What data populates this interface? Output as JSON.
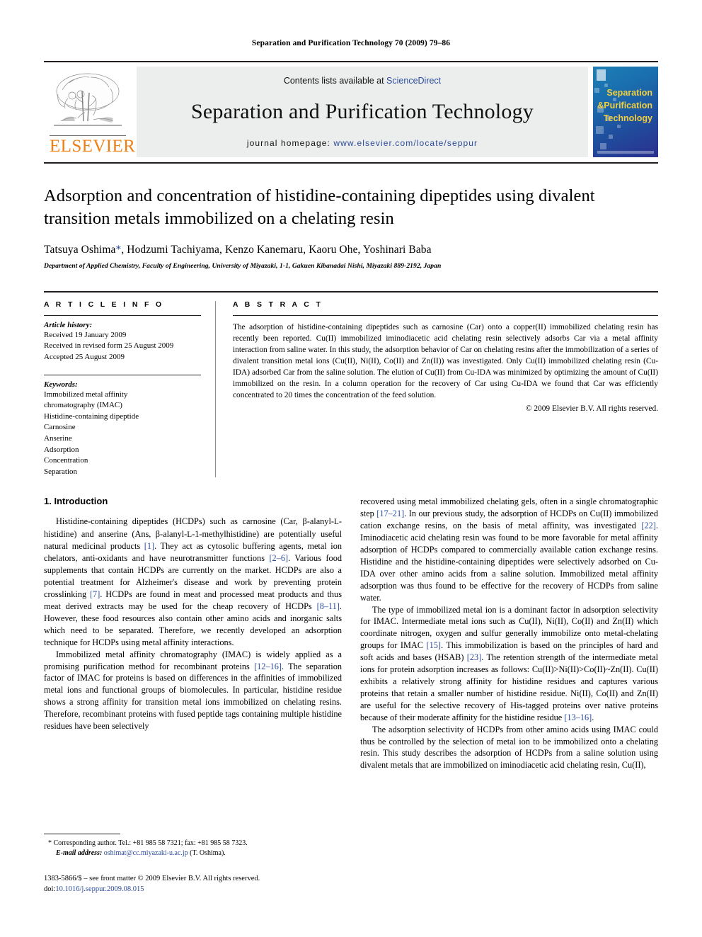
{
  "running_head": "Separation and Purification Technology 70 (2009) 79–86",
  "masthead": {
    "publisher_name": "ELSEVIER",
    "contents_prefix": "Contents lists available at ",
    "contents_link": "ScienceDirect",
    "journal_title": "Separation and Purification Technology",
    "homepage_prefix": "journal homepage: ",
    "homepage_url": "www.elsevier.com/locate/seppur",
    "cover_title_line1": "Separation",
    "cover_title_line2": "&Purification",
    "cover_title_line3": "Technology"
  },
  "article": {
    "title": "Adsorption and concentration of histidine-containing dipeptides using divalent transition metals immobilized on a chelating resin",
    "authors": "Tatsuya Oshima",
    "authors_rest": ", Hodzumi Tachiyama, Kenzo Kanemaru, Kaoru Ohe, Yoshinari Baba",
    "corresponding_marker": "*",
    "affiliation": "Department of Applied Chemistry, Faculty of Engineering, University of Miyazaki, 1-1, Gakuen Kibanadai Nishi, Miyazaki 889-2192, Japan"
  },
  "article_info": {
    "heading": "A R T I C L E  I N F O",
    "history_label": "Article history:",
    "history": [
      "Received 19 January 2009",
      "Received in revised form 25 August 2009",
      "Accepted 25 August 2009"
    ],
    "keywords_label": "Keywords:",
    "keywords": [
      "Immobilized metal affinity",
      "chromatography (IMAC)",
      "Histidine-containing dipeptide",
      "Carnosine",
      "Anserine",
      "Adsorption",
      "Concentration",
      "Separation"
    ]
  },
  "abstract": {
    "heading": "A B S T R A C T",
    "text": "The adsorption of histidine-containing dipeptides such as carnosine (Car) onto a copper(II) immobilized chelating resin has recently been reported. Cu(II) immobilized iminodiacetic acid chelating resin selectively adsorbs Car via a metal affinity interaction from saline water. In this study, the adsorption behavior of Car on chelating resins after the immobilization of a series of divalent transition metal ions (Cu(II), Ni(II), Co(II) and Zn(II)) was investigated. Only Cu(II) immobilized chelating resin (Cu-IDA) adsorbed Car from the saline solution. The elution of Cu(II) from Cu-IDA was minimized by optimizing the amount of Cu(II) immobilized on the resin. In a column operation for the recovery of Car using Cu-IDA we found that Car was efficiently concentrated to 20 times the concentration of the feed solution.",
    "copyright": "© 2009 Elsevier B.V. All rights reserved."
  },
  "body": {
    "section_number_title": "1.  Introduction",
    "left_paragraphs": [
      {
        "segments": [
          {
            "t": "Histidine-containing dipeptides (HCDPs) such as carnosine (Car, β-alanyl-"
          },
          {
            "t": "L",
            "style": "sc"
          },
          {
            "t": "-histidine) and anserine (Ans, β-alanyl-"
          },
          {
            "t": "L",
            "style": "sc"
          },
          {
            "t": "-1-methylhistidine) are potentially useful natural medicinal products "
          },
          {
            "t": "[1]",
            "style": "ref"
          },
          {
            "t": ". They act as cytosolic buffering agents, metal ion chelators, anti-oxidants and have neurotransmitter functions "
          },
          {
            "t": "[2–6]",
            "style": "ref"
          },
          {
            "t": ". Various food supplements that contain HCDPs are currently on the market. HCDPs are also a potential treatment for Alzheimer's disease and work by preventing protein crosslinking "
          },
          {
            "t": "[7]",
            "style": "ref"
          },
          {
            "t": ". HCDPs are found in meat and processed meat products and thus meat derived extracts may be used for the cheap recovery of HCDPs "
          },
          {
            "t": "[8–11]",
            "style": "ref"
          },
          {
            "t": ". However, these food resources also contain other amino acids and inorganic salts which need to be separated. Therefore, we recently developed an adsorption technique for HCDPs using metal affinity interactions."
          }
        ]
      },
      {
        "segments": [
          {
            "t": "Immobilized metal affinity chromatography (IMAC) is widely applied as a promising purification method for recombinant proteins "
          },
          {
            "t": "[12–16]",
            "style": "ref"
          },
          {
            "t": ". The separation factor of IMAC for proteins is based on differences in the affinities of immobilized metal ions and functional groups of biomolecules. In particular, histidine residue shows a strong affinity for transition metal ions immobilized on chelating resins. Therefore, recombinant proteins with fused peptide tags containing multiple histidine residues have been selectively"
          }
        ]
      }
    ],
    "right_paragraphs": [
      {
        "no_indent": true,
        "segments": [
          {
            "t": "recovered using metal immobilized chelating gels, often in a single chromatographic step "
          },
          {
            "t": "[17–21]",
            "style": "ref"
          },
          {
            "t": ". In our previous study, the adsorption of HCDPs on Cu(II) immobilized cation exchange resins, on the basis of metal affinity, was investigated "
          },
          {
            "t": "[22]",
            "style": "ref"
          },
          {
            "t": ". Iminodiacetic acid chelating resin was found to be more favorable for metal affinity adsorption of HCDPs compared to commercially available cation exchange resins. Histidine and the histidine-containing dipeptides were selectively adsorbed on Cu-IDA over other amino acids from a saline solution. Immobilized metal affinity adsorption was thus found to be effective for the recovery of HCDPs from saline water."
          }
        ]
      },
      {
        "segments": [
          {
            "t": "The type of immobilized metal ion is a dominant factor in adsorption selectivity for IMAC. Intermediate metal ions such as Cu(II), Ni(II), Co(II) and Zn(II) which coordinate nitrogen, oxygen and sulfur generally immobilize onto metal-chelating groups for IMAC "
          },
          {
            "t": "[15]",
            "style": "ref"
          },
          {
            "t": ". This immobilization is based on the principles of hard and soft acids and bases (HSAB) "
          },
          {
            "t": "[23]",
            "style": "ref"
          },
          {
            "t": ". The retention strength of the intermediate metal ions for protein adsorption increases as follows: Cu(II)>Ni(II)>Co(II)~Zn(II). Cu(II) exhibits a relatively strong affinity for histidine residues and captures various proteins that retain a smaller number of histidine residue. Ni(II), Co(II) and Zn(II) are useful for the selective recovery of His-tagged proteins over native proteins because of their moderate affinity for the histidine residue "
          },
          {
            "t": "[13–16]",
            "style": "ref"
          },
          {
            "t": "."
          }
        ]
      },
      {
        "segments": [
          {
            "t": "The adsorption selectivity of HCDPs from other amino acids using IMAC could thus be controlled by the selection of metal ion to be immobilized onto a chelating resin. This study describes the adsorption of HCDPs from a saline solution using divalent metals that are immobilized on iminodiacetic acid chelating resin, Cu(II),"
          }
        ]
      }
    ]
  },
  "footnotes": {
    "corresponding_marker": "*",
    "corresponding_text": "Corresponding author. Tel.: +81 985 58 7321; fax: +81 985 58 7323.",
    "email_label": "E-mail address:",
    "email": "oshimat@cc.miyazaki-u.ac.jp",
    "email_suffix": " (T. Oshima).",
    "issn_line": "1383-5866/$ – see front matter © 2009 Elsevier B.V. All rights reserved.",
    "doi_label": "doi:",
    "doi": "10.1016/j.seppur.2009.08.015"
  },
  "colors": {
    "link_blue": "#2b4c9b",
    "elsevier_orange": "#f07f13",
    "masthead_gray": "#eceded",
    "cover_yellow": "#f2cf3c"
  }
}
